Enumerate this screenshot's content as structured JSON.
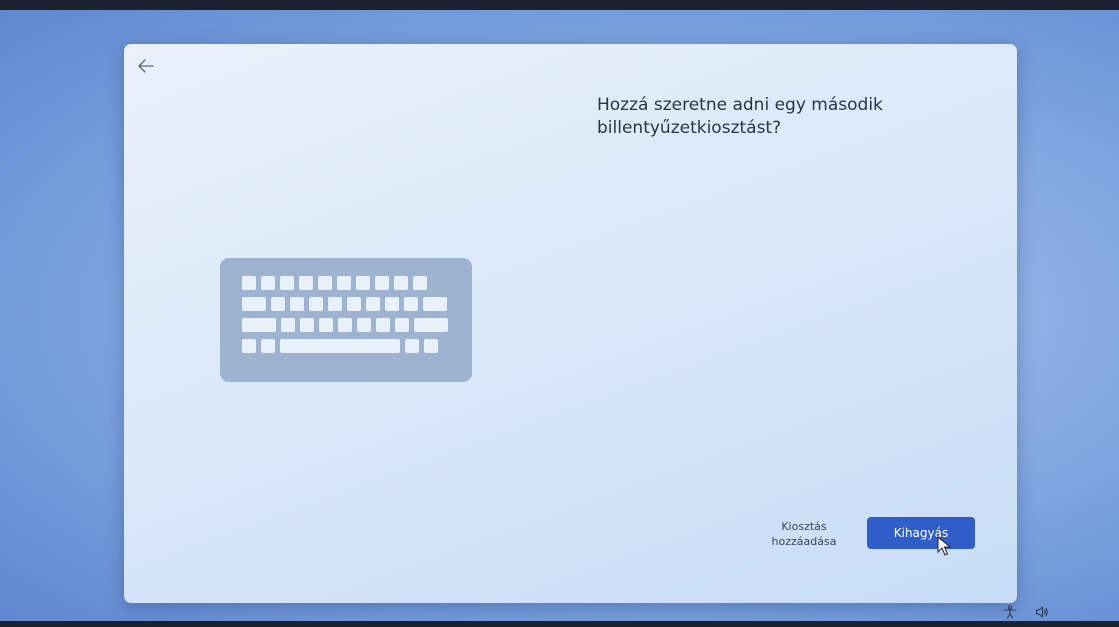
{
  "dialog": {
    "title": "Hozzá szeretne adni egy második billentyűzetkiosztást?",
    "back_icon": "arrow-left-icon",
    "illustration_icon": "keyboard-icon"
  },
  "actions": {
    "add_layout_label": "Kiosztás\nhozzáadása",
    "skip_label": "Kihagyás"
  },
  "taskbar": {
    "icons": [
      "accessibility-icon",
      "volume-icon"
    ]
  },
  "colors": {
    "primary_button": "#2f5ec8",
    "keyboard_body": "#9db3d0",
    "keys": "#e8f0fa"
  }
}
